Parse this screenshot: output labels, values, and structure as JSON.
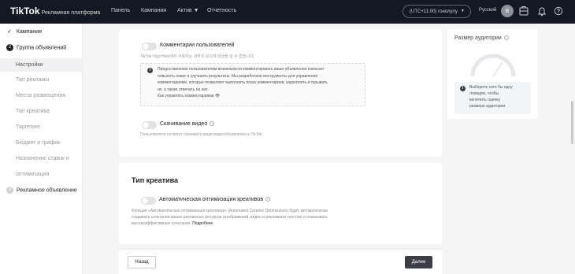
{
  "header": {
    "logo": "TikTok",
    "logo_sub": "Рекламная платформа",
    "nav": [
      "Панель",
      "Кампания",
      "Актив",
      "Отчетность"
    ],
    "timezone": "(UTC+11:00) гонолулу",
    "language": "Русский",
    "avatar_letter": "B"
  },
  "sidebar": {
    "campaign": "Кампания",
    "adgroup": "Группа объявлений",
    "adgroup_step": "2",
    "sub_items": [
      "Настройки",
      "Тип рекламы",
      "Места размещения",
      "Тип креатива",
      "Таргетинг",
      "Бюджет и график",
      "Назначение ставок и",
      "оптимизация"
    ],
    "ad": "Рекламное объявление",
    "ad_step": "3"
  },
  "comments_section": {
    "label": "Комментарии пользователей",
    "hint": "TikTok Vigo Helo에서 사용자는 귀하의 광고에 댓글을 달 수 없습니다.",
    "info_lines": [
      "Предоставление пользователям возможности комментировать ваши объявления помогает",
      "повысить охват и улучшить результаты. Мы разработали инструменты для управления",
      "комментариями, которые позволяют выполнять поиск комментариев, закреплять и скрывать",
      "их, а также отвечать на них."
    ],
    "info_link": "Как управлять комментариями"
  },
  "download_section": {
    "label": "Скачивание видео",
    "hint": "Пользователи не могут скачивать ваши видеообъявления в TikTok."
  },
  "creative_section": {
    "title": "Тип креатива",
    "label": "Автоматическая оптимизация креативов",
    "desc_lines": [
      "Функция «Автоматическая оптимизация креативов» (Automated Creative Optimization) будет автоматически",
      "создавать сочетания ваших рекламных ресурсов (изображений, видео и рекламных текстов) и показывать",
      "высокоэффективные сочетания."
    ],
    "more": "Подробнее"
  },
  "audience": {
    "title": "Размер аудитории",
    "note_lines": [
      "Выберите хотя бы одну",
      "локацию, чтобы",
      "включить оценку",
      "размера аудитории."
    ]
  },
  "footer": {
    "back": "Назад",
    "next": "Далее"
  },
  "colors": {
    "topbar": "#141824",
    "primary_button": "#3a3d46",
    "page_bg": "#f5f5f6"
  }
}
